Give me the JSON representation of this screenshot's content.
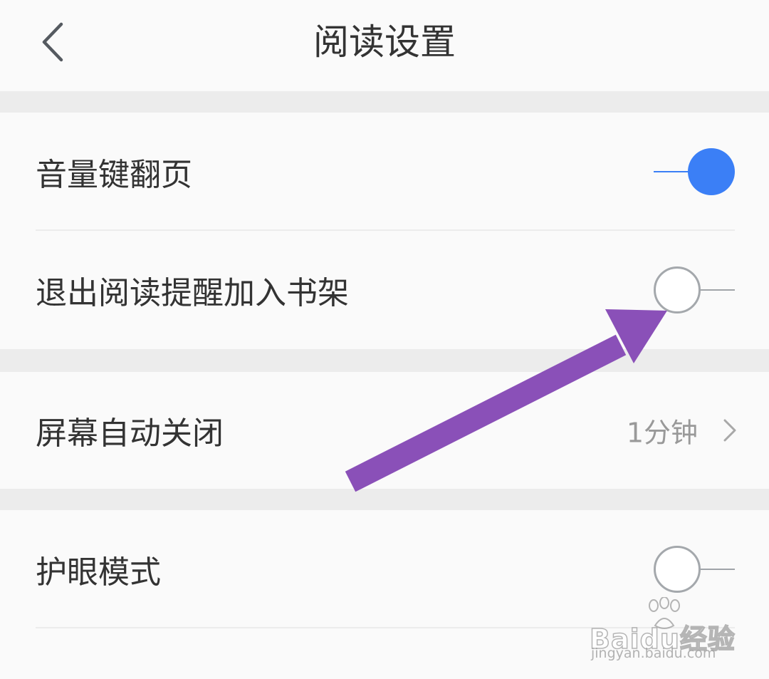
{
  "header": {
    "title": "阅读设置",
    "back_icon": "chevron-left-icon"
  },
  "settings": {
    "volume_key_flip": {
      "label": "音量键翻页",
      "enabled": true
    },
    "exit_reminder": {
      "label": "退出阅读提醒加入书架",
      "enabled": false
    },
    "screen_timeout": {
      "label": "屏幕自动关闭",
      "value": "1分钟",
      "icon": "chevron-right-icon"
    },
    "eye_protection": {
      "label": "护眼模式",
      "enabled": false
    },
    "next_item_partial": {
      "label": ""
    }
  },
  "annotation": {
    "arrow_color": "#8a50b8",
    "points_to": "exit-reminder-toggle"
  },
  "colors": {
    "accent": "#3b7ff6",
    "background": "#ececec",
    "card": "#fafafa",
    "text": "#333333",
    "secondary_text": "#999999"
  },
  "watermark": {
    "brand": "Baidu经验",
    "url": "jingyan.baidu.com"
  }
}
